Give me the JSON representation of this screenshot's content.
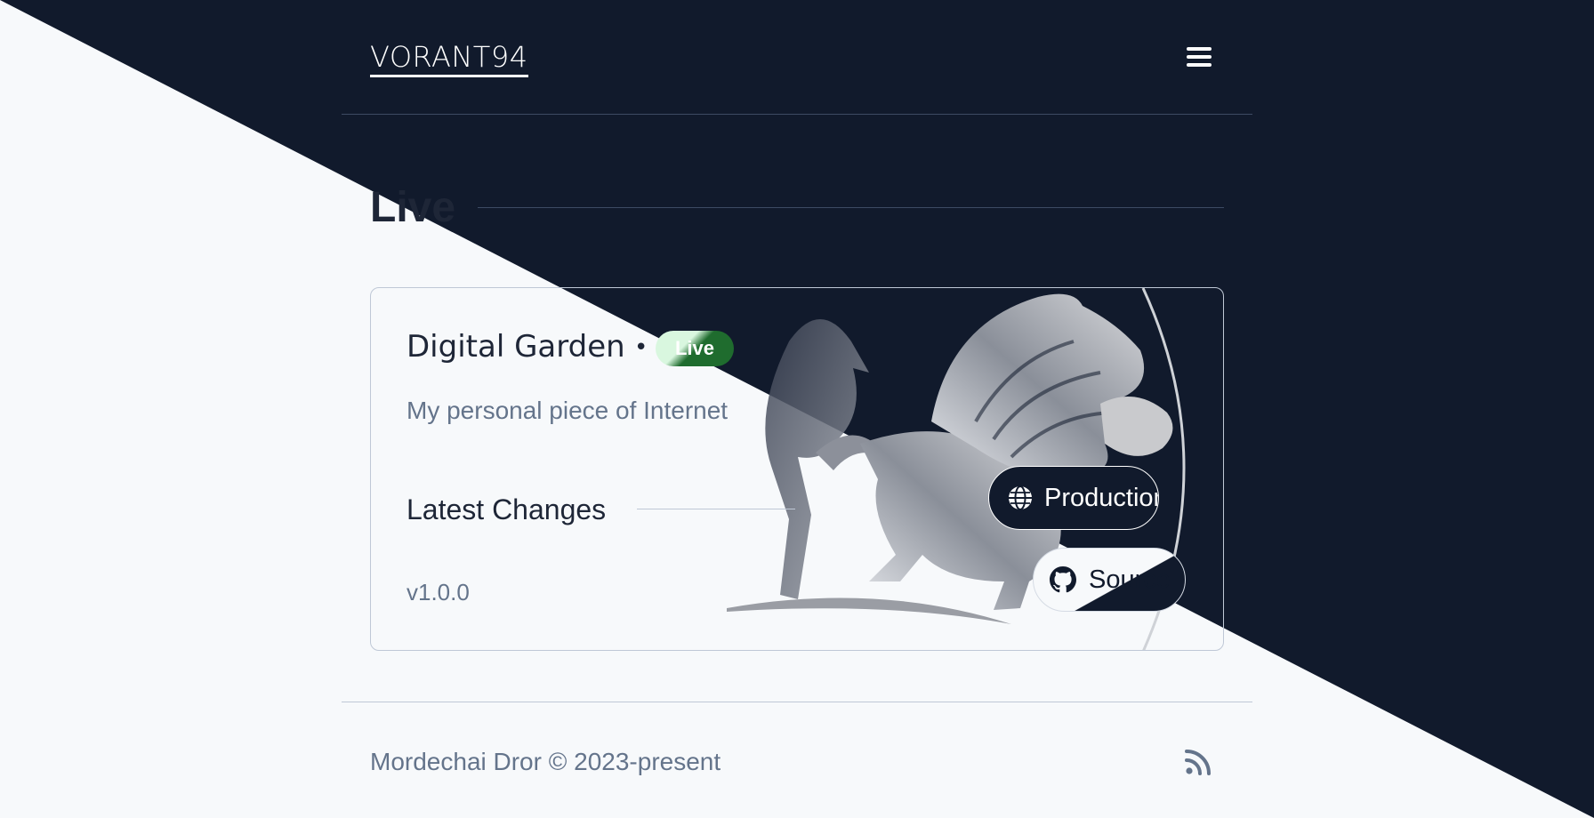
{
  "header": {
    "logo_text": "VORANT94",
    "menu_icon": "hamburger-icon"
  },
  "section": {
    "title": "Live"
  },
  "project": {
    "name": "Digital Garden",
    "separator": "•",
    "status_badge": "Live",
    "description": "My personal piece of Internet",
    "changes_heading": "Latest Changes",
    "version": "v1.0.0",
    "image_icon": "magpie-bird-illustration",
    "links": [
      {
        "label": "Production",
        "icon": "globe-icon"
      },
      {
        "label": "Source",
        "icon": "github-icon"
      }
    ]
  },
  "footer": {
    "copyright": "Mordechai Dror © 2023-present",
    "rss_icon": "rss-icon"
  },
  "colors": {
    "dark_background": "#111a2c",
    "light_background": "#f7f9fb",
    "muted_text": "#64748b",
    "border": "#bfc8d6",
    "live_badge_dark": "#1f6c2e",
    "live_badge_light": "#d9f7df"
  }
}
